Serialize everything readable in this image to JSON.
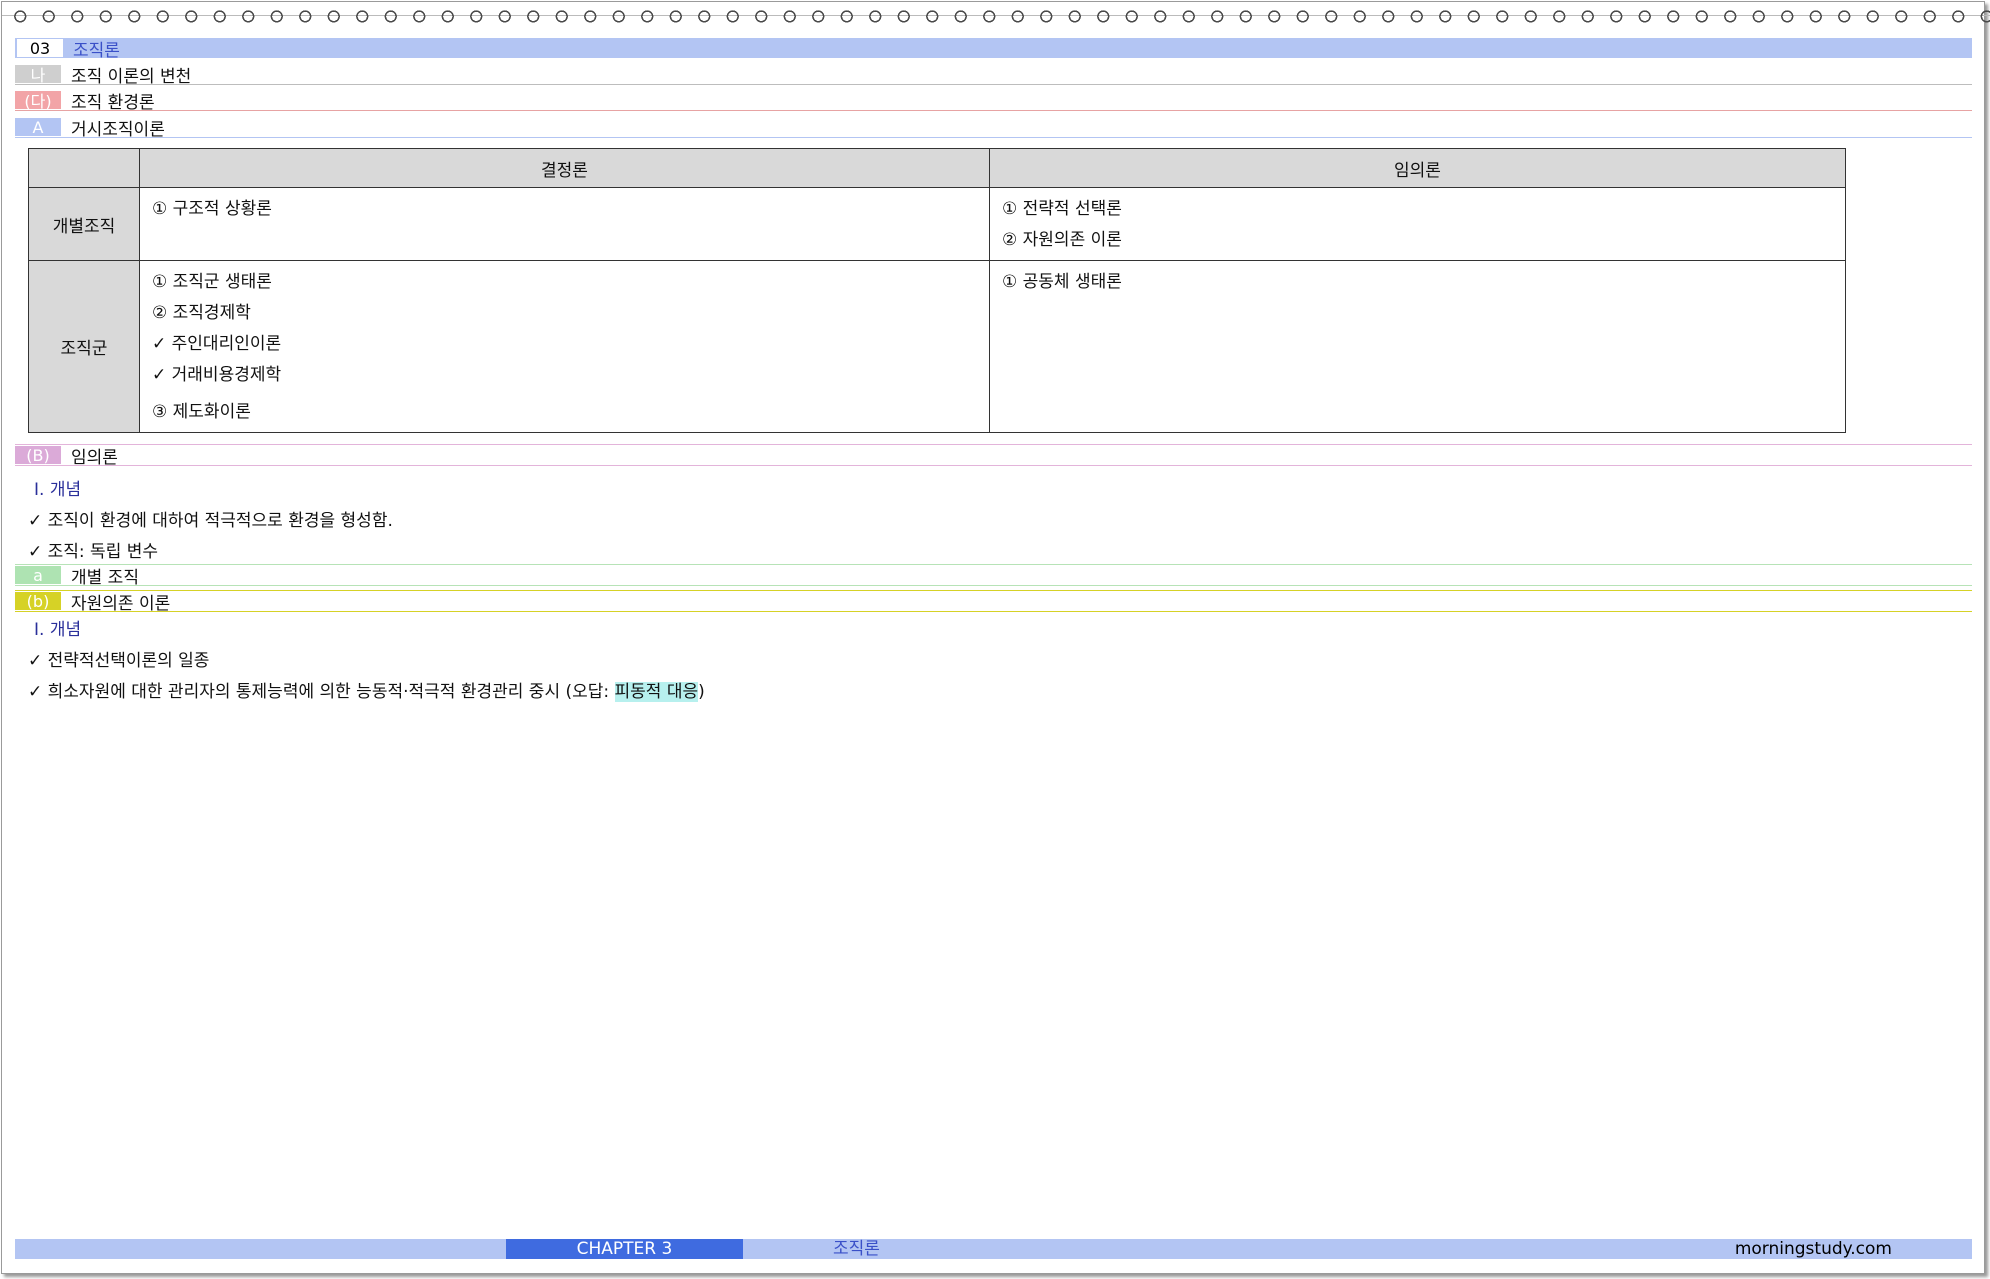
{
  "chapter_header": {
    "number": "03",
    "title": "조직론"
  },
  "section_na": {
    "tag": "나",
    "title": "조직 이론의 변천"
  },
  "section_da": {
    "tag": "(다)",
    "title": "조직 환경론"
  },
  "section_a": {
    "tag": "A",
    "title": "거시조직이론"
  },
  "table": {
    "columns": [
      "결정론",
      "임의론"
    ],
    "rows": [
      {
        "label": "개별조직",
        "determinism": [
          "① 구조적 상황론"
        ],
        "voluntarism": [
          "① 전략적 선택론",
          "② 자원의존 이론"
        ]
      },
      {
        "label": "조직군",
        "determinism": [
          "① 조직군 생태론",
          "② 조직경제학",
          "✓ 주인대리인이론",
          "✓ 거래비용경제학",
          "③ 제도화이론"
        ],
        "voluntarism": [
          "① 공동체 생태론"
        ]
      }
    ]
  },
  "section_b": {
    "tag": "(B)",
    "title": "임의론",
    "roman": "Ⅰ. 개념",
    "items": [
      "✓ 조직이 환경에 대하여 적극적으로 환경을 형성함.",
      "✓ 조직: 독립 변수"
    ]
  },
  "section_sa": {
    "tag": "a",
    "title": "개별 조직"
  },
  "section_sb": {
    "tag": "(b)",
    "title": "자원의존 이론",
    "roman": "Ⅰ. 개념",
    "item1": "✓ 전략적선택이론의 일종",
    "item2_prefix": "✓ 희소자원에 대한 관리자의 통제능력에 의한 능동적·적극적 환경관리 중시 (오답: ",
    "item2_highlight": "피동적 대응",
    "item2_suffix": ")"
  },
  "footer": {
    "chapter": "CHAPTER 3",
    "title": "조직론",
    "site": "morningstudy.com"
  }
}
